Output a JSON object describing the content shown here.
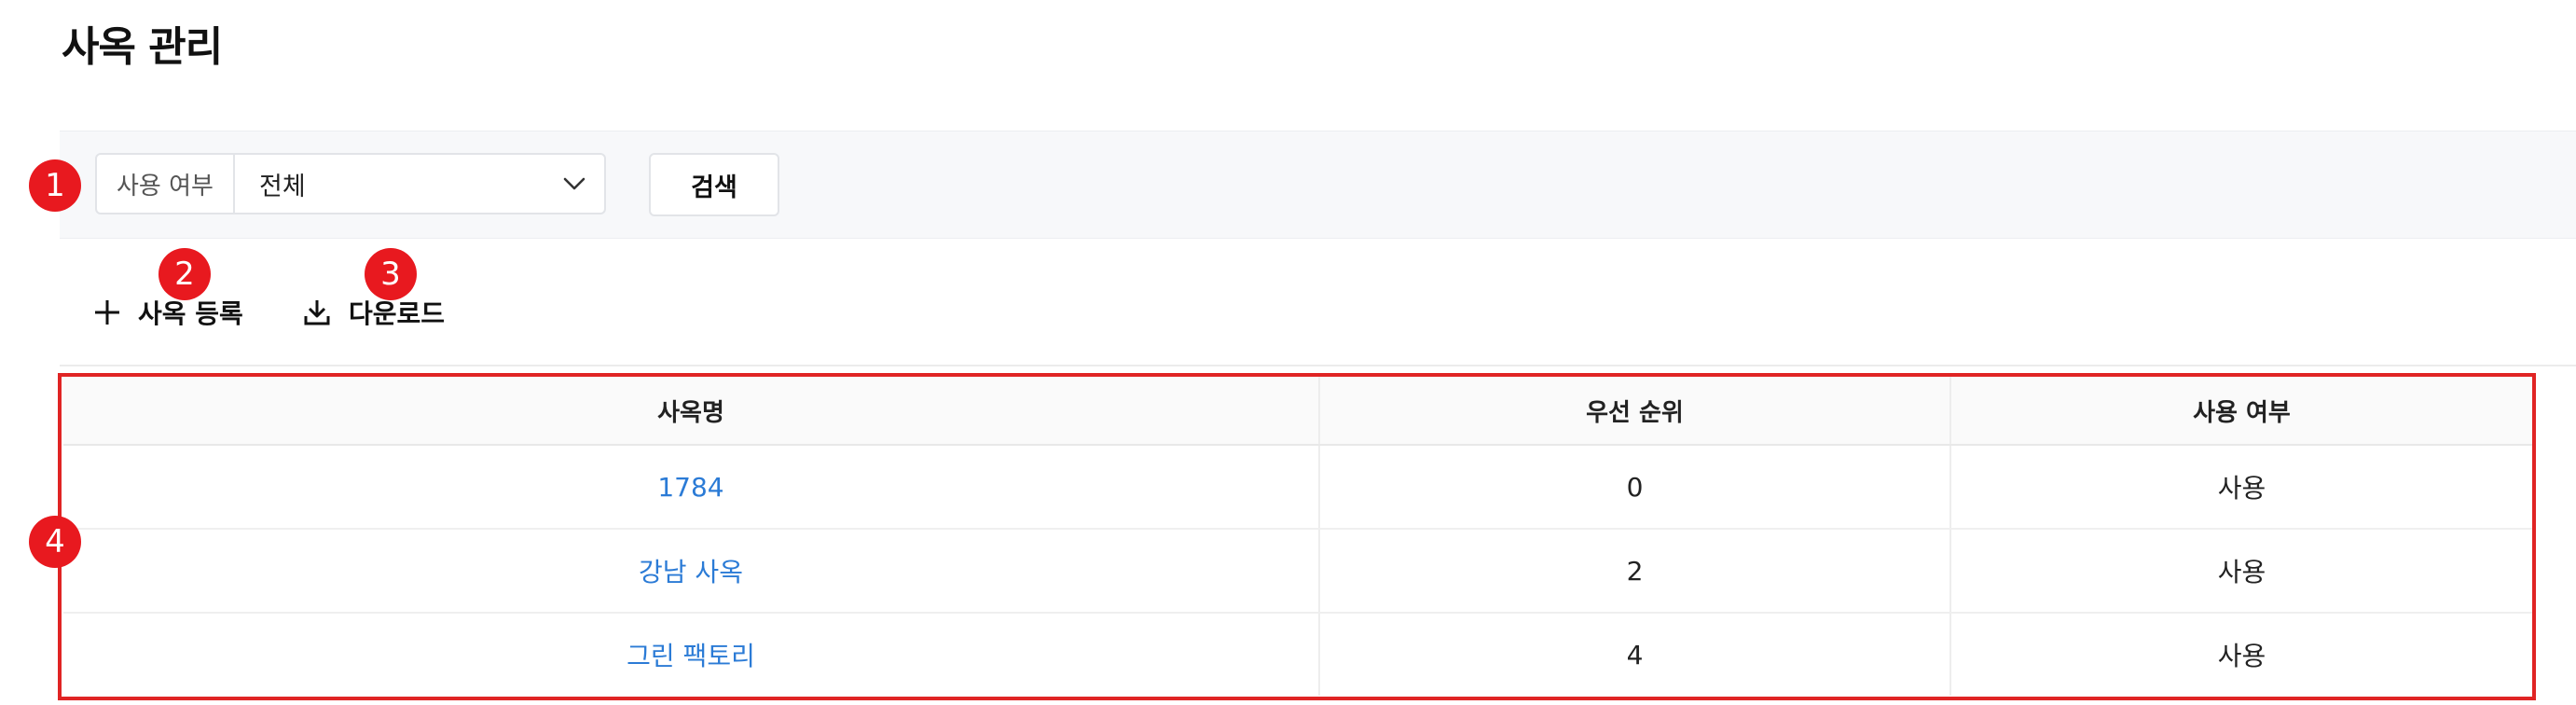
{
  "page": {
    "title": "사옥 관리"
  },
  "filter": {
    "label": "사용 여부",
    "value": "전체",
    "search_label": "검색"
  },
  "actions": {
    "add_label": "사옥 등록",
    "download_label": "다운로드"
  },
  "table": {
    "headers": [
      "사옥명",
      "우선 순위",
      "사용 여부"
    ],
    "rows": [
      {
        "name": "1784",
        "priority": "0",
        "status": "사용"
      },
      {
        "name": "강남 사옥",
        "priority": "2",
        "status": "사용"
      },
      {
        "name": "그린 팩토리",
        "priority": "4",
        "status": "사용"
      }
    ]
  },
  "callouts": [
    "1",
    "2",
    "3",
    "4"
  ],
  "icons": {
    "chevron": "chevron-down-icon",
    "add": "plus-icon",
    "download": "download-icon"
  },
  "colors": {
    "link": "#2b7bd6",
    "callout": "#e8191f",
    "highlight": "#e02424"
  }
}
